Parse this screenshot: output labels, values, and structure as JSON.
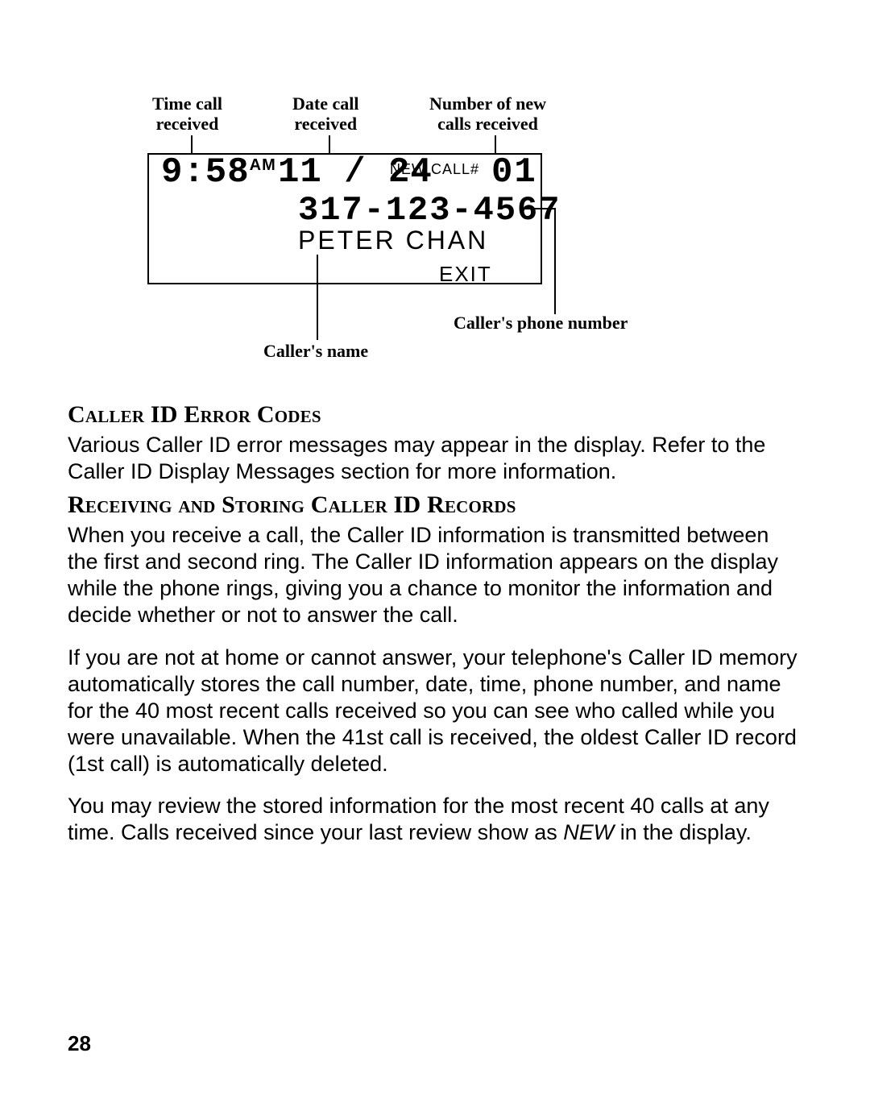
{
  "diagram": {
    "callouts": {
      "time": "Time call\nreceived",
      "date": "Date call\nreceived",
      "newcalls": "Number of new\ncalls received",
      "phone": "Caller's phone number",
      "name": "Caller's name"
    },
    "lcd": {
      "time": "9:58",
      "ampm": "AM",
      "date": "11 / 24",
      "newcall_label": "NEW CALL#",
      "newcall_num": "01",
      "phone": "317-123-4567",
      "name": "PETER CHAN",
      "exit": "EXIT"
    }
  },
  "sections": {
    "h1": "Caller ID Error Codes",
    "p1": "Various Caller ID error messages may appear in the display. Refer to the Caller ID Display Messages section for more information.",
    "h2": "Receiving and Storing Caller ID Records",
    "p2": "When you receive a call, the Caller ID information is transmitted between the first and second ring. The Caller ID information appears on the display while the phone rings, giving you a chance to monitor the information and decide whether or not to answer the call.",
    "p3": "If you are not at home or cannot answer, your telephone's Caller ID memory automatically stores the call number, date, time, phone number, and name for the 40 most recent calls received so you can see who called while you were unavailable. When the 41st call is received, the oldest Caller ID record (1st call) is automatically deleted.",
    "p4a": "You may review the stored information for the most recent 40 calls at any time. Calls received since your last review show as ",
    "p4i": "NEW",
    "p4b": " in the display."
  },
  "page_number": "28"
}
